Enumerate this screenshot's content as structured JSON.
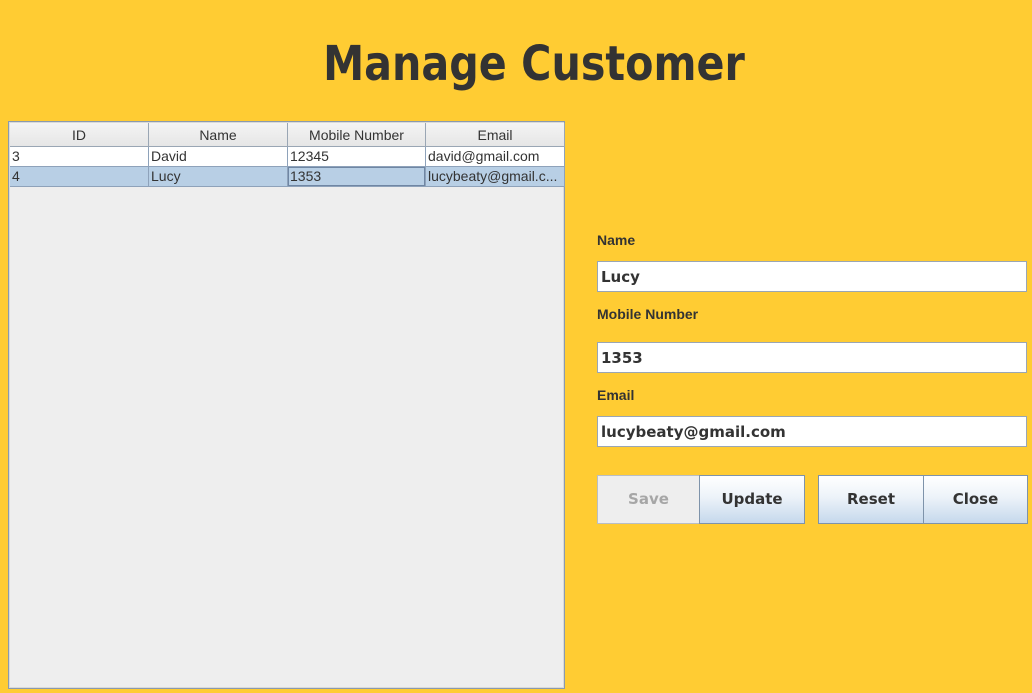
{
  "title": "Manage Customer",
  "table": {
    "columns": [
      "ID",
      "Name",
      "Mobile Number",
      "Email"
    ],
    "rows": [
      [
        "3",
        "David",
        "12345",
        "david@gmail.com"
      ],
      [
        "4",
        "Lucy",
        "1353",
        "lucybeaty@gmail.c..."
      ]
    ],
    "selected_row": 1
  },
  "form": {
    "name_label": "Name",
    "name_value": "Lucy",
    "mobile_label": "Mobile Number",
    "mobile_value": "1353",
    "email_label": "Email",
    "email_value": "lucybeaty@gmail.com"
  },
  "buttons": {
    "save": "Save",
    "update": "Update",
    "reset": "Reset",
    "close": "Close"
  },
  "colors": {
    "background": "#FFCC33",
    "title_text": "#333333",
    "selected_row": "#B8CFE5"
  }
}
